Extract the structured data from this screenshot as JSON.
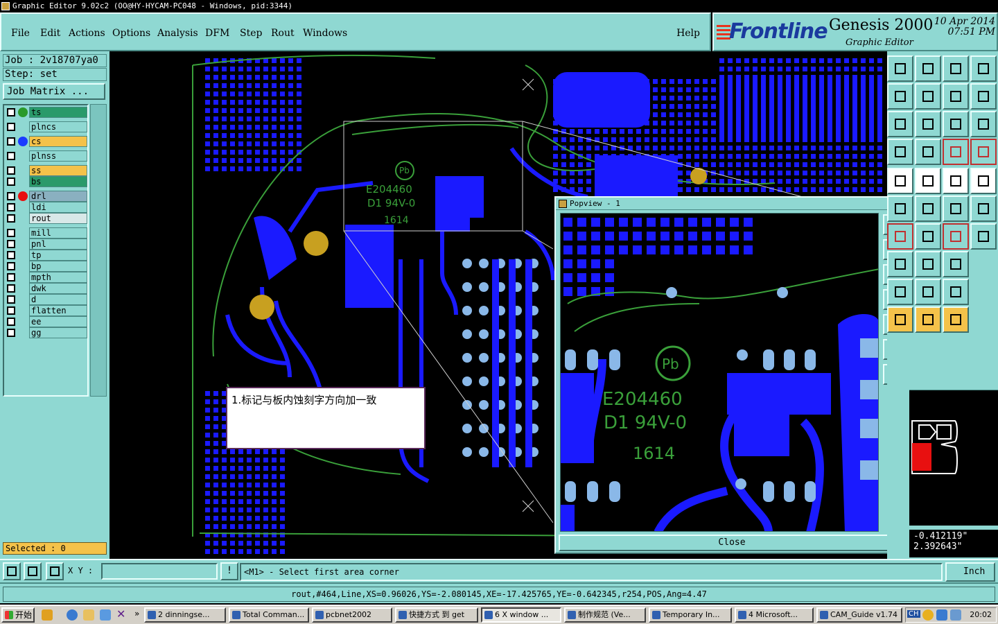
{
  "window": {
    "title": "Graphic Editor 9.02c2 (OO@HY-HYCAM-PC048 - Windows, pid:3344)"
  },
  "menu": {
    "items": [
      "File",
      "Edit",
      "Actions",
      "Options",
      "Analysis",
      "DFM",
      "Step",
      "Rout",
      "Windows"
    ],
    "help": "Help"
  },
  "logo": {
    "brand": "Frontline",
    "product": "Genesis 2000",
    "subtitle": "Graphic Editor",
    "date": "10 Apr 2014",
    "time": "07:51 PM"
  },
  "job": {
    "job_line": "Job : 2v18707ya0",
    "step_line": "Step: set",
    "matrix_button": "Job Matrix ..."
  },
  "layers": [
    {
      "name": "ts",
      "color": "#2a9a6a",
      "dot": "#2a9a2a"
    },
    {
      "name": "plncs",
      "color": "#8fd8d2",
      "dot": ""
    },
    {
      "name": "cs",
      "color": "#f4c24a",
      "dot": "#1a3aff"
    },
    {
      "name": "plnss",
      "color": "#8fd8d2",
      "dot": ""
    },
    {
      "name": "ss",
      "color": "#f4c24a",
      "dot": ""
    },
    {
      "name": "bs",
      "color": "#2a9a6a",
      "dot": ""
    },
    {
      "name": "drl",
      "color": "#8ab0c0",
      "dot": "#e81010"
    },
    {
      "name": "ldi",
      "color": "#8fd8d2",
      "dot": ""
    },
    {
      "name": "rout",
      "color": "#d8e8e8",
      "dot": ""
    },
    {
      "name": "mill",
      "color": "#8fd8d2",
      "dot": ""
    },
    {
      "name": "pnl",
      "color": "#8fd8d2",
      "dot": ""
    },
    {
      "name": "tp",
      "color": "#8fd8d2",
      "dot": ""
    },
    {
      "name": "bp",
      "color": "#8fd8d2",
      "dot": ""
    },
    {
      "name": "mpth",
      "color": "#8fd8d2",
      "dot": ""
    },
    {
      "name": "dwk",
      "color": "#8fd8d2",
      "dot": ""
    },
    {
      "name": "d",
      "color": "#8fd8d2",
      "dot": ""
    },
    {
      "name": "flatten",
      "color": "#8fd8d2",
      "dot": ""
    },
    {
      "name": "ee",
      "color": "#8fd8d2",
      "dot": ""
    },
    {
      "name": "gg",
      "color": "#8fd8d2",
      "dot": ""
    }
  ],
  "selected": "Selected : 0",
  "board_text": {
    "ul_code": "E204460",
    "rating": "D1 94V-0",
    "date_code": "1614",
    "pb": "Pb"
  },
  "note": {
    "text": "1.标记与板内蚀刻字方向加一致"
  },
  "popview": {
    "title": "Popview - 1",
    "close_label": "Close",
    "close_x": "×"
  },
  "coords": {
    "x": "-0.412119\"",
    "y": "2.392643\""
  },
  "status": {
    "xy_label": "X Y :",
    "xy_value": "",
    "warn": "!",
    "prompt": "<M1> - Select first area corner",
    "units": "Inch",
    "info": "rout,#464,Line,XS=0.96026,YS=-2.080145,XE=-17.425765,YE=-0.642345,r254,POS,Ang=4.47"
  },
  "taskbar": {
    "start": "开始",
    "chevron": "»",
    "tasks": [
      {
        "label": "2 dinningse...",
        "active": false
      },
      {
        "label": "Total Comman...",
        "active": false
      },
      {
        "label": "pcbnet2002",
        "active": false
      },
      {
        "label": "快捷方式 到 get",
        "active": false
      },
      {
        "label": "6 X window ...",
        "active": true
      },
      {
        "label": "制作规范 (Ve...",
        "active": false
      },
      {
        "label": "Temporary In...",
        "active": false
      },
      {
        "label": "4 Microsoft...",
        "active": false
      },
      {
        "label": "CAM_Guide v1.74",
        "active": false
      }
    ],
    "tray_label": "CH",
    "clock": "20:02"
  },
  "colors": {
    "panel": "#8fd8d2",
    "copper": "#1a1aff",
    "silk": "#3aa03a",
    "pad": "#8ab8e8",
    "hole": "#c8a020"
  }
}
